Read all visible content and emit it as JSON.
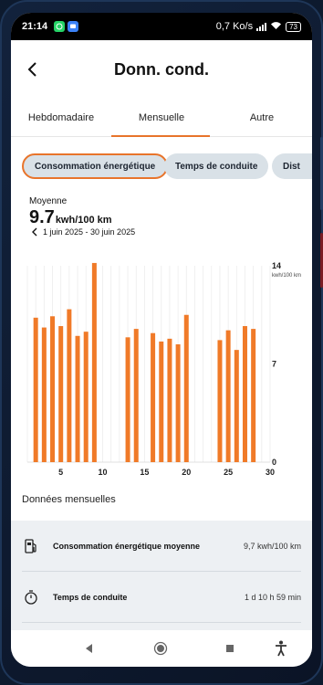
{
  "status_bar": {
    "time": "21:14",
    "network_speed": "0,7 Ko/s",
    "battery": "73"
  },
  "header": {
    "title": "Donn. cond."
  },
  "tabs": [
    {
      "label": "Hebdomadaire",
      "active": false
    },
    {
      "label": "Mensuelle",
      "active": true
    },
    {
      "label": "Autre",
      "active": false
    }
  ],
  "chips": [
    {
      "label": "Consommation énergétique",
      "selected": true
    },
    {
      "label": "Temps de conduite",
      "selected": false
    },
    {
      "label": "Dist",
      "selected": false
    }
  ],
  "summary": {
    "label": "Moyenne",
    "value": "9.7",
    "unit": "kwh/100 km",
    "period": "1 juin 2025 - 30 juin 2025"
  },
  "colors": {
    "accent": "#e8742b",
    "bar": "#f07a28",
    "card_bg": "#edf0f3"
  },
  "chart_data": {
    "type": "bar",
    "x": [
      2,
      3,
      4,
      5,
      6,
      7,
      8,
      9,
      13,
      14,
      16,
      17,
      18,
      19,
      20,
      24,
      25,
      26,
      27,
      28
    ],
    "values": [
      10.3,
      9.6,
      10.4,
      9.7,
      10.9,
      9.0,
      9.3,
      14.2,
      8.9,
      9.5,
      9.2,
      8.6,
      8.8,
      8.4,
      10.5,
      8.7,
      9.4,
      8.0,
      9.7,
      9.5
    ],
    "xlim": [
      1,
      30
    ],
    "ylim": [
      0,
      14
    ],
    "x_ticks": [
      "5",
      "10",
      "15",
      "20",
      "25",
      "30"
    ],
    "y_ticks": [
      "14",
      "7",
      "0"
    ],
    "y_unit": "kwh/100 km",
    "grid": "vertical"
  },
  "section": {
    "title": "Données mensuelles",
    "rows": [
      {
        "icon": "fuel-pump-icon",
        "label": "Consommation énergétique moyenne",
        "value": "9,7 kwh/100 km"
      },
      {
        "icon": "stopwatch-icon",
        "label": "Temps de conduite",
        "value": "1 d 10 h 59 min"
      }
    ]
  },
  "navbar": {
    "icons": [
      "back-triangle-icon",
      "home-circle-icon",
      "recent-square-icon",
      "accessibility-icon"
    ]
  }
}
